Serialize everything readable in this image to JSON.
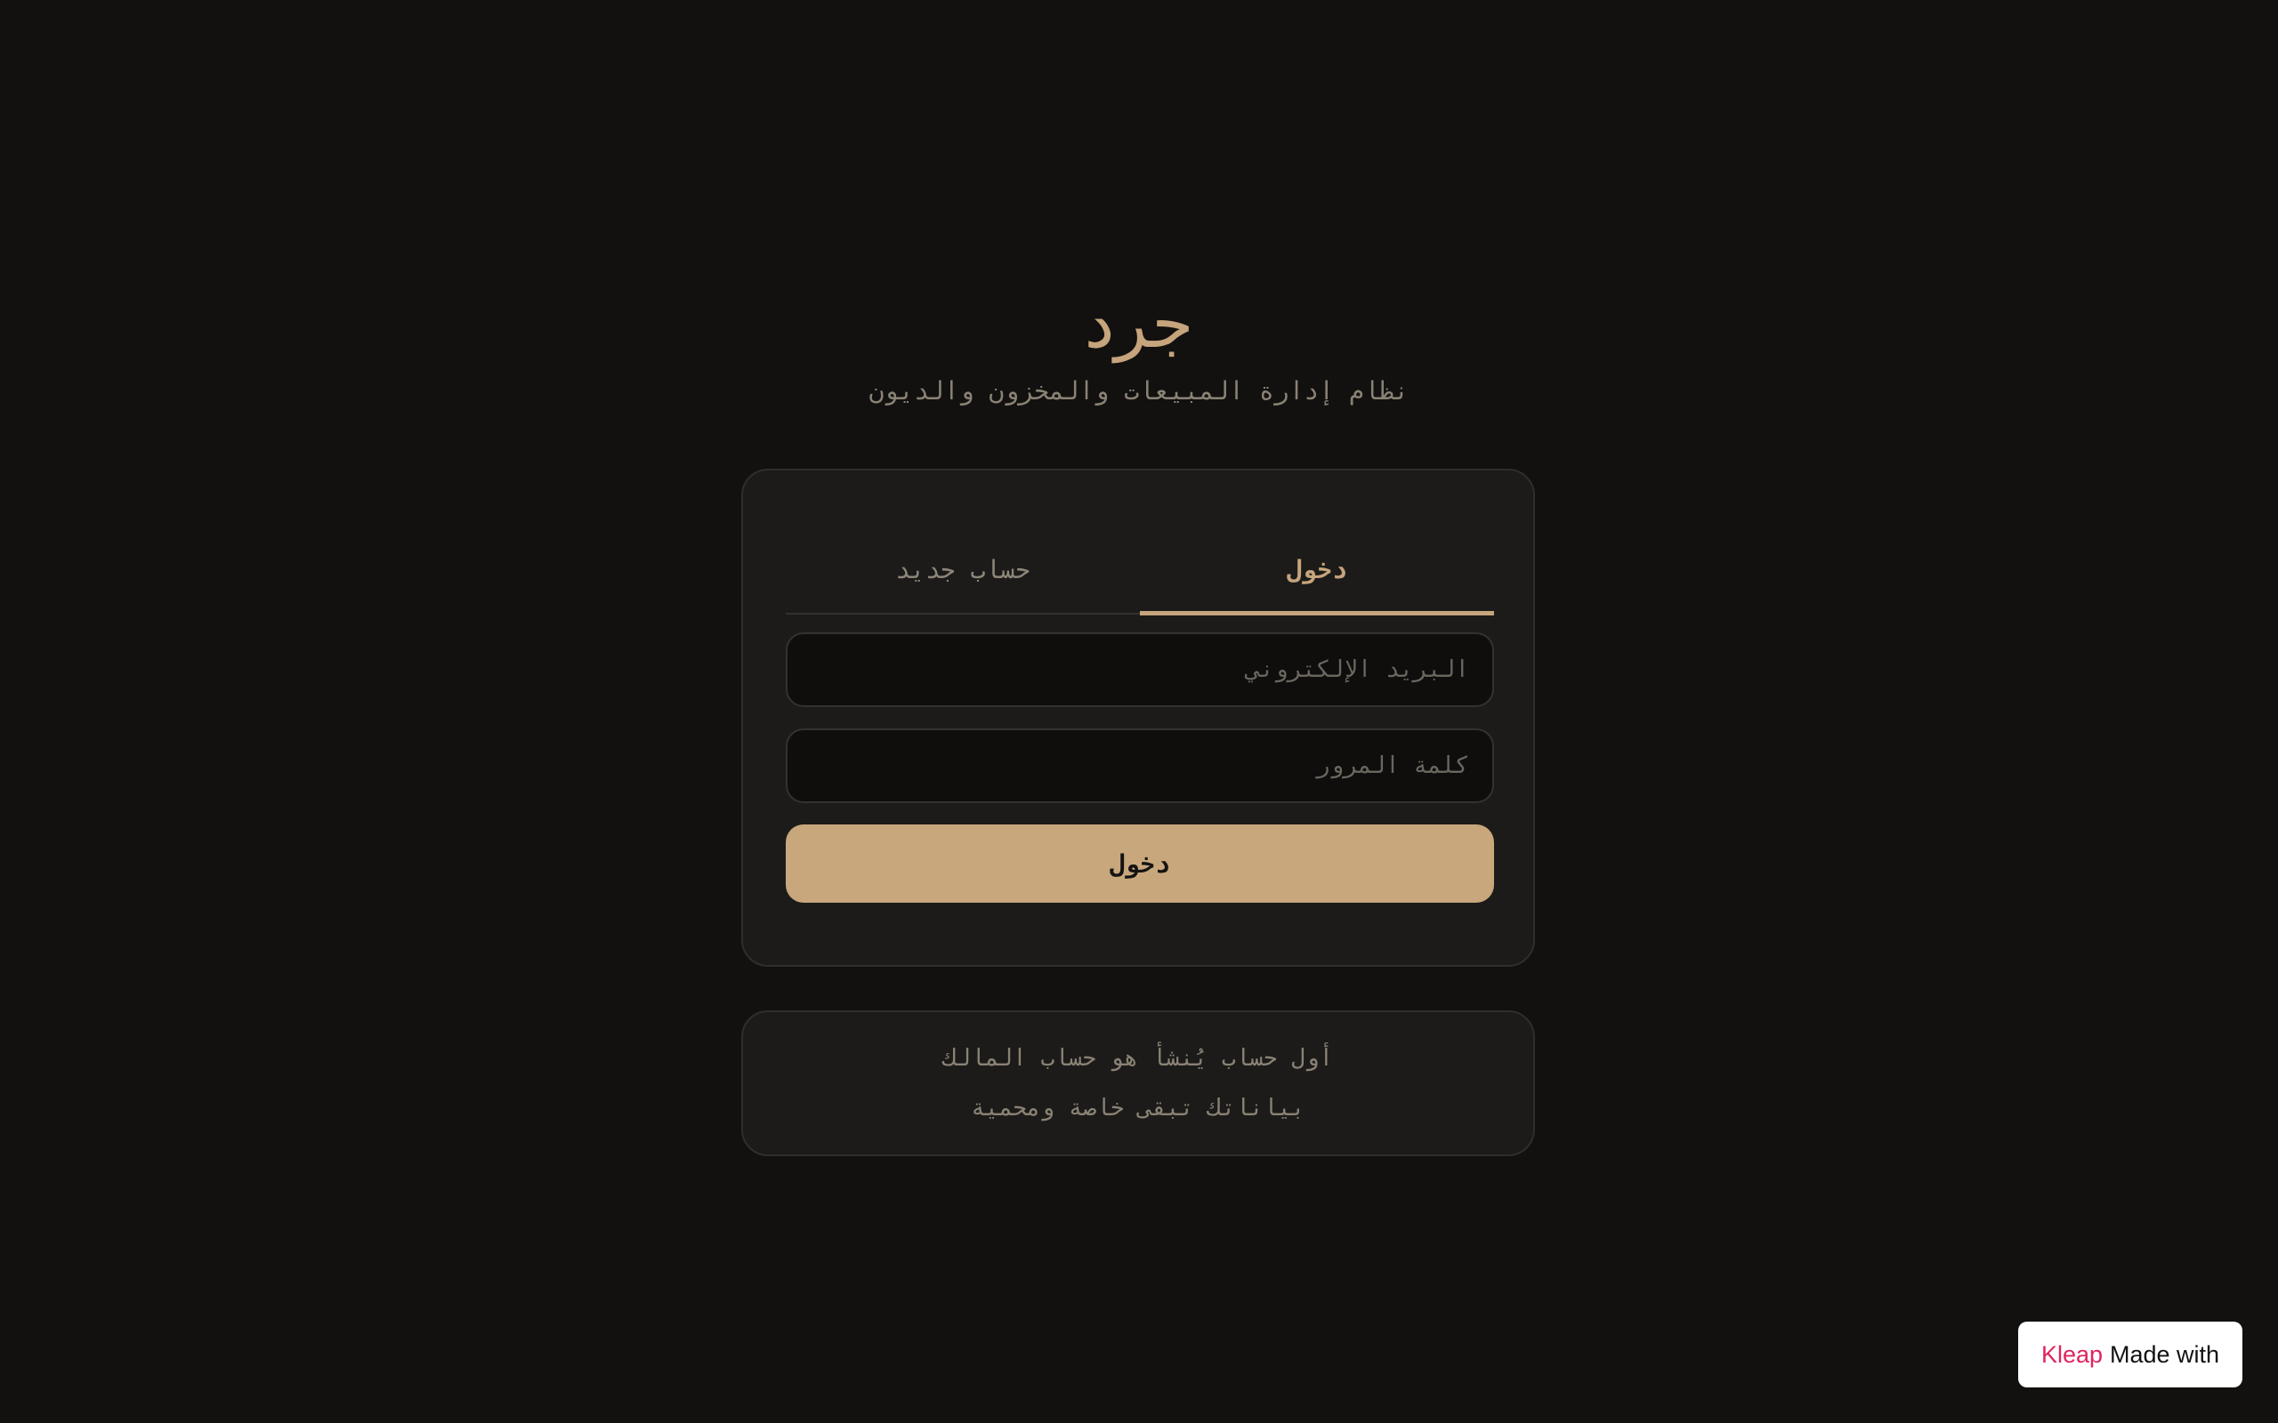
{
  "header": {
    "brand": "جرد",
    "subtitle": "نظام إدارة المبيعات والمخزون والديون"
  },
  "auth": {
    "tabs": [
      {
        "label": "دخول",
        "active": true
      },
      {
        "label": "حساب جديد",
        "active": false
      }
    ],
    "email_placeholder": "البريد الإلكتروني",
    "password_placeholder": "كلمة المرور",
    "submit_label": "دخول"
  },
  "info": {
    "line1": "أول حساب يُنشأ هو حساب المالك",
    "line2": "بياناتك تبقى خاصة ومحمية"
  },
  "badge": {
    "brand": "Kleap",
    "text": "Made with"
  },
  "colors": {
    "background": "#121110",
    "accent": "#c6a47c",
    "card": "#1c1b1a"
  }
}
